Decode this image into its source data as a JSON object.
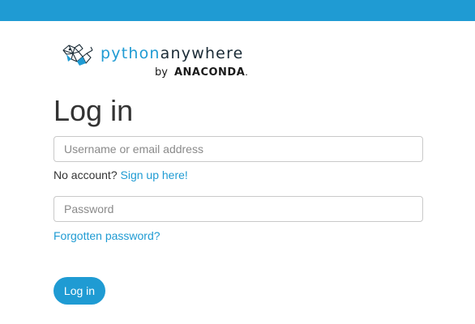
{
  "brand": {
    "wordmark_part1": "python",
    "wordmark_part2": "anywhere",
    "byline_by": "by",
    "byline_company": "ANACONDA",
    "byline_dot": ".",
    "colors": {
      "accent": "#1f9bd3",
      "dark": "#1a2b36"
    }
  },
  "page": {
    "title": "Log in"
  },
  "form": {
    "username": {
      "placeholder": "Username or email address",
      "value": ""
    },
    "no_account_text": "No account?",
    "signup_link": "Sign up here!",
    "password": {
      "placeholder": "Password",
      "value": ""
    },
    "forgot_link": "Forgotten password?",
    "submit_label": "Log in"
  }
}
